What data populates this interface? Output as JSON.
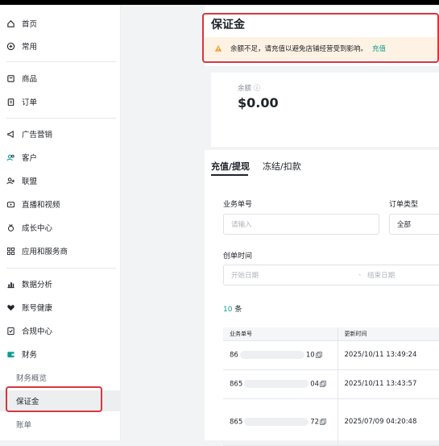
{
  "sidebar": {
    "items": [
      {
        "label": "首页",
        "icon": "home-icon"
      },
      {
        "label": "常用",
        "icon": "plus-circle-icon"
      },
      {
        "label": "商品",
        "icon": "box-icon"
      },
      {
        "label": "订单",
        "icon": "clipboard-icon"
      },
      {
        "label": "广告营销",
        "icon": "megaphone-icon"
      },
      {
        "label": "客户",
        "icon": "users-icon"
      },
      {
        "label": "联盟",
        "icon": "user-plus-icon"
      },
      {
        "label": "直播和视频",
        "icon": "video-icon"
      },
      {
        "label": "成长中心",
        "icon": "medal-icon"
      },
      {
        "label": "应用和服务商",
        "icon": "apps-icon"
      },
      {
        "label": "数据分析",
        "icon": "chart-icon"
      },
      {
        "label": "账号健康",
        "icon": "heart-icon"
      },
      {
        "label": "合规中心",
        "icon": "document-check-icon"
      },
      {
        "label": "财务",
        "icon": "wallet-icon"
      }
    ],
    "finance_sub": [
      "财务概览",
      "保证金",
      "账单"
    ]
  },
  "page": {
    "title": "保证金",
    "alert_text": "余额不足，请充值以避免店铺经营受到影响。",
    "alert_link": "充值",
    "balance_label": "余额 ⓘ",
    "balance_value": "$0.00"
  },
  "tabs": [
    "充值/提现",
    "冻结/扣款"
  ],
  "filters": {
    "order_no_label": "业务单号",
    "order_no_placeholder": "请输入",
    "order_type_label": "订单类型",
    "order_type_value": "全部",
    "created_time_label": "创单时间",
    "start_placeholder": "开始日期",
    "separator": "-",
    "end_placeholder": "结束日期"
  },
  "results": {
    "count": "10",
    "unit": "条"
  },
  "table": {
    "headers": [
      "业务单号",
      "更新时间"
    ],
    "rows": [
      {
        "order_prefix": "86",
        "order_suffix": "10",
        "updated": "2025/10/11 13:49:24"
      },
      {
        "order_prefix": "865",
        "order_suffix": "04",
        "updated": "2025/10/11 13:43:57"
      },
      {
        "order_prefix": "865",
        "order_suffix": "72",
        "updated": "2025/07/09 04:20:48"
      }
    ]
  },
  "colors": {
    "accent": "#0a9d8f",
    "warning": "#e8a33d",
    "highlight": "#d9363e"
  }
}
